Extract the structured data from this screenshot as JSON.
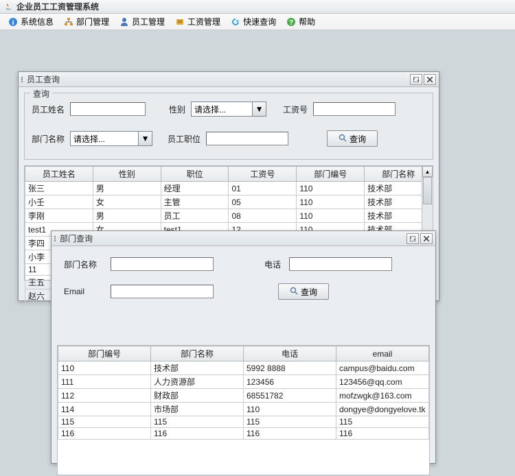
{
  "app": {
    "title": "企业员工工资管理系统"
  },
  "menu": {
    "system": "系统信息",
    "dept_mgmt": "部门管理",
    "emp_mgmt": "员工管理",
    "salary_mgmt": "工资管理",
    "quick_query": "快速查询",
    "help": "帮助"
  },
  "emp_window": {
    "title": "员工查询",
    "group": "查询",
    "labels": {
      "name": "员工姓名",
      "gender": "性别",
      "salary_id": "工资号",
      "dept_name": "部门名称",
      "position": "员工职位"
    },
    "gender_placeholder": "请选择...",
    "dept_placeholder": "请选择...",
    "search_btn": "查询",
    "columns": [
      "员工姓名",
      "性别",
      "职位",
      "工资号",
      "部门编号",
      "部门名称"
    ],
    "rows": [
      [
        "张三",
        "男",
        "经理",
        "01",
        "110",
        "技术部"
      ],
      [
        "小壬",
        "女",
        "主管",
        "05",
        "110",
        "技术部"
      ],
      [
        "李刚",
        "男",
        "员工",
        "08",
        "110",
        "技术部"
      ],
      [
        "test1",
        "女",
        "test1",
        "12",
        "110",
        "技术部"
      ],
      [
        "李四",
        "",
        "",
        "",
        "",
        ""
      ],
      [
        "小李",
        "",
        "",
        "",
        "",
        ""
      ],
      [
        "11",
        "",
        "",
        "",
        "",
        ""
      ],
      [
        "王五",
        "",
        "",
        "",
        "",
        ""
      ],
      [
        "赵六",
        "",
        "",
        "",
        "",
        ""
      ]
    ]
  },
  "dept_window": {
    "title": "部门查询",
    "labels": {
      "dept_name": "部门名称",
      "phone": "电话",
      "email": "Email"
    },
    "search_btn": "查询",
    "columns": [
      "部门编号",
      "部门名称",
      "电话",
      "email"
    ],
    "rows": [
      [
        "110",
        "技术部",
        "5992 8888",
        "campus@baidu.com"
      ],
      [
        "111",
        "人力资源部",
        "123456",
        "123456@qq.com"
      ],
      [
        "112",
        "财政部",
        "68551782",
        "mofzwgk@163.com"
      ],
      [
        "114",
        "市场部",
        "110",
        "dongye@dongyelove.tk"
      ],
      [
        "115",
        "115",
        "115",
        "115"
      ],
      [
        "116",
        "116",
        "116",
        "116"
      ]
    ]
  }
}
